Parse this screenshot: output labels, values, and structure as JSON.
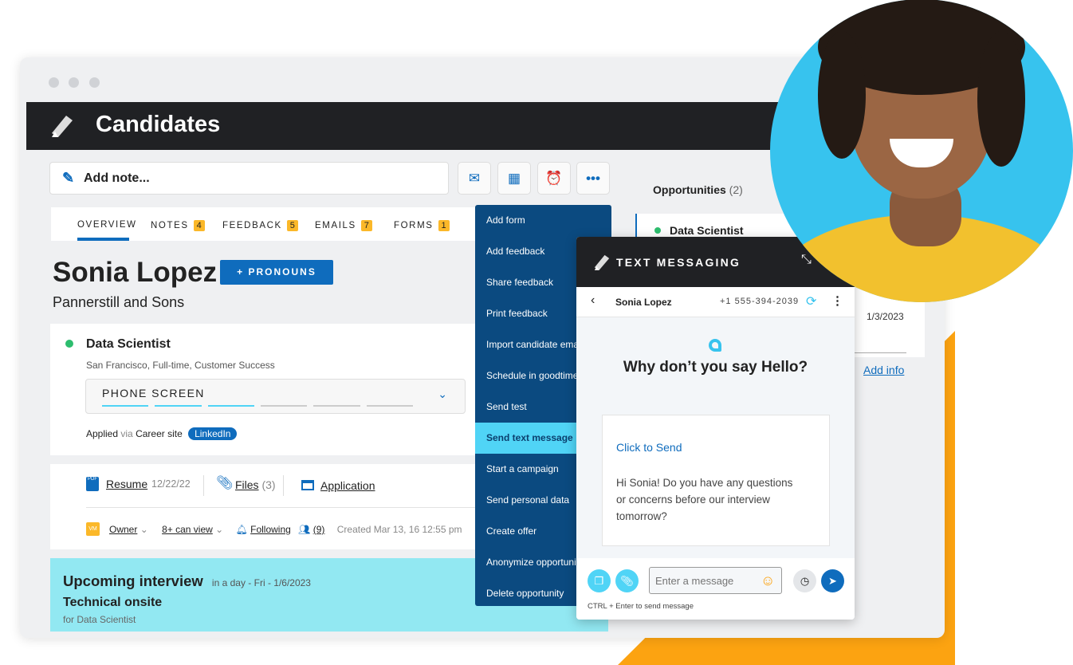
{
  "app": {
    "title": "Candidates"
  },
  "toolbar": {
    "add_note": "Add note...",
    "icons": [
      "mail-icon",
      "calendar-icon",
      "alarm-icon",
      "more-icon"
    ]
  },
  "tabs": [
    {
      "label": "OVERVIEW",
      "active": true
    },
    {
      "label": "NOTES",
      "count": "4"
    },
    {
      "label": "FEEDBACK",
      "count": "5"
    },
    {
      "label": "EMAILS",
      "count": "7"
    },
    {
      "label": "FORMS",
      "count": "1"
    }
  ],
  "candidate": {
    "name": "Sonia Lopez",
    "pronouns_button": "+ PRONOUNS",
    "company": "Pannerstill and Sons"
  },
  "job": {
    "title": "Data Scientist",
    "details": "San Francisco, Full-time, Customer Success",
    "stage": "PHONE SCREEN",
    "stage_progress": "3 of 6",
    "applied": "Applied",
    "via": "via",
    "source": "Career site",
    "source_tag": "LinkedIn"
  },
  "files": {
    "resume": "Resume",
    "resume_date": "12/22/22",
    "files": "Files",
    "files_count": "(3)",
    "application": "Application"
  },
  "meta": {
    "avatar": "VM",
    "owner": "Owner",
    "can_view": "8+ can view",
    "following": "Following",
    "followers": "(9)",
    "created": "Created Mar 13, 16 12:55 pm"
  },
  "interview": {
    "title": "Upcoming interview",
    "when": "in a day - Fri - 1/6/2023",
    "name": "Technical onsite",
    "for": "for Data Scientist"
  },
  "opportunities": {
    "label": "Opportunities",
    "count": "(2)",
    "item": "Data Scientist",
    "date": "1/3/2023",
    "add_info": "Add info"
  },
  "menu": [
    "Add form",
    "Add feedback",
    "Share feedback",
    "Print feedback",
    "Import candidate email",
    "Schedule in goodtime",
    "Send test",
    "Send text message",
    "Start a campaign",
    "Send personal data",
    "Create offer",
    "Anonymize opportunity",
    "Delete opportunity"
  ],
  "texting": {
    "title": "TEXT MESSAGING",
    "contact": "Sonia Lopez",
    "phone": "+1 555-394-2039",
    "prompt": "Why don’t you say Hello?",
    "click_to_send": "Click to Send",
    "template": "Hi Sonia! Do you have any questions or concerns before our interview tomorrow?",
    "placeholder": "Enter a message",
    "hint": "CTRL + Enter to send message"
  },
  "colors": {
    "accent": "#0f6cbd",
    "header": "#202124",
    "menu": "#0b4a80",
    "highlight": "#50d4f6",
    "badge": "#fbb829",
    "orange": "#fca311",
    "interview_bg": "#92e8f2"
  }
}
